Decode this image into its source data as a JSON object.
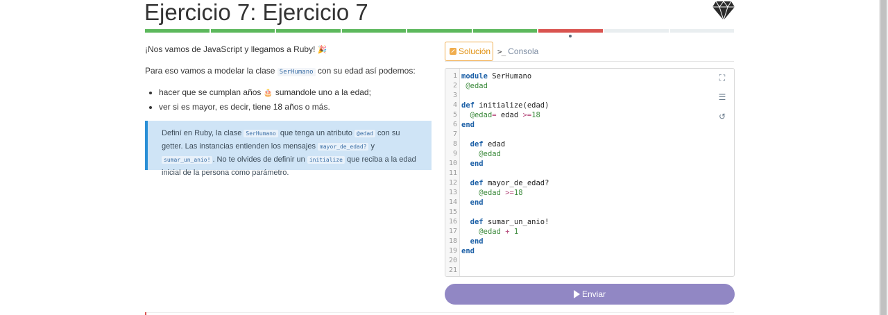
{
  "header": {
    "title": "Ejercicio 7: Ejercicio 7",
    "logo_icon": "ruby-gem-icon"
  },
  "progress": {
    "segments": [
      "ok",
      "ok",
      "ok",
      "ok",
      "ok",
      "ok",
      "err",
      "pending",
      "pending"
    ],
    "current_index": 6
  },
  "description": {
    "intro": "¡Nos vamos de JavaScript y llegamos a Ruby!",
    "line2_before": "Para eso vamos a modelar la clase",
    "line2_code": "SerHumano",
    "line2_after": "con su edad así podemos:",
    "items": [
      {
        "before": "hacer que se cumplan años",
        "after": "sumandole uno a la edad;"
      },
      {
        "text": "ver si es mayor, es decir, tiene 18 años o más."
      }
    ],
    "callout": {
      "t1": "Definí en Ruby, la clase",
      "c1": "SerHumano",
      "t2": "que tenga un atributo",
      "c2": "@edad",
      "t3": "con su getter. Las instancias entienden los mensajes",
      "c3": "mayor_de_edad?",
      "t4": "y",
      "c4": "sumar_un_anio!",
      "t5": ". No te olvides de definir un",
      "c5": "initialize",
      "t6": "que reciba a la edad inicial de la persona como parámetro."
    }
  },
  "tabs": {
    "solution": "Solución",
    "console": "Consola"
  },
  "editor": {
    "line_numbers": [
      "1",
      "2",
      "3",
      "4",
      "5",
      "6",
      "7",
      "8",
      "9",
      "10",
      "11",
      "12",
      "13",
      "14",
      "15",
      "16",
      "17",
      "18",
      "19",
      "20",
      "21"
    ],
    "tools": [
      "expand-icon",
      "indent-icon",
      "reset-icon"
    ]
  },
  "send_button": {
    "label": "Enviar"
  }
}
